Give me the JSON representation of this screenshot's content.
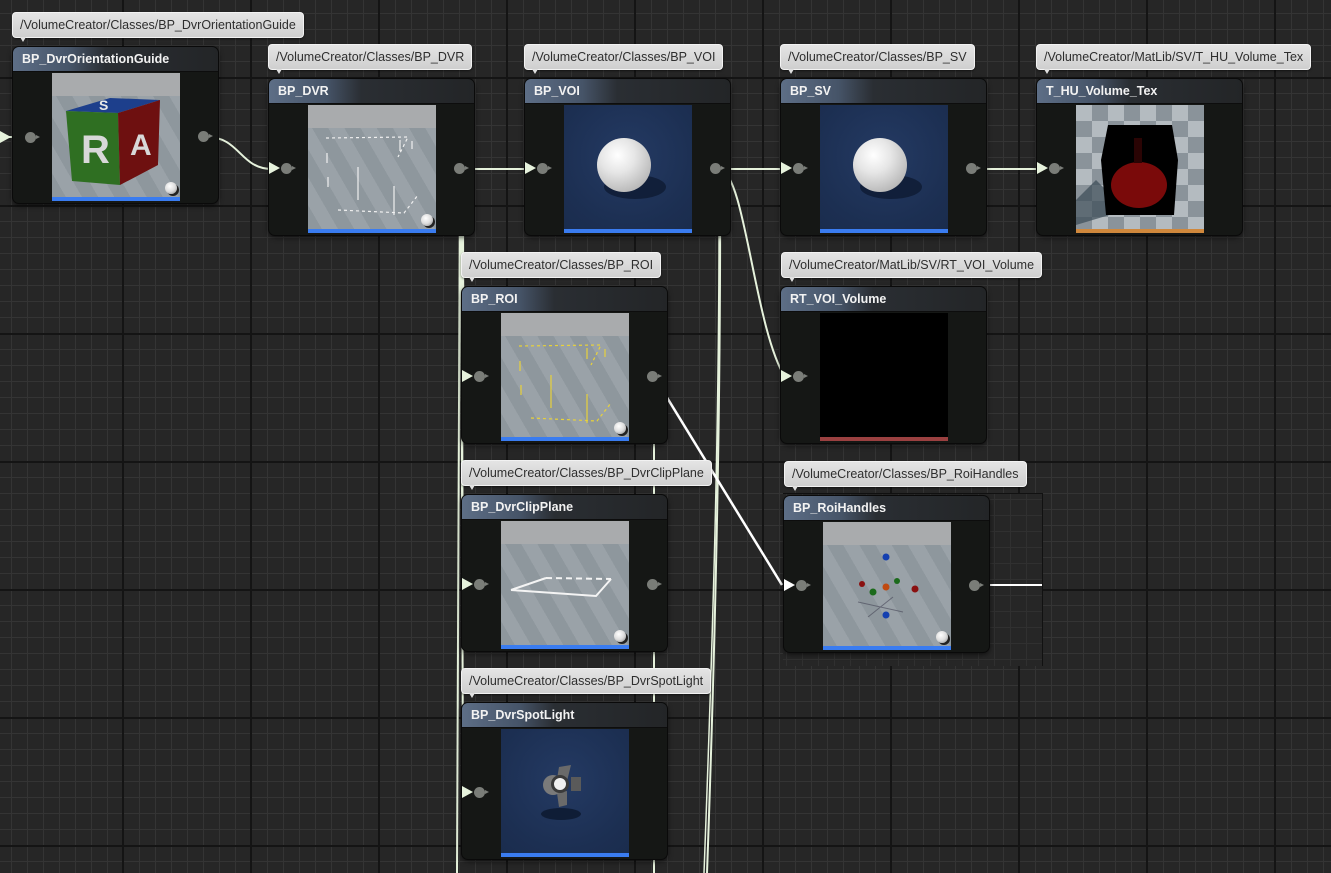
{
  "canvas": {
    "type": "reference-viewer-graph",
    "background": "#262626"
  },
  "colors": {
    "wire": "#e6f2dc",
    "wire_selected": "#ffffff",
    "blueprint_bar": "#3a7cf0",
    "texture_bar": "#d0883c",
    "render_target_bar": "#9a4040"
  },
  "nodes": [
    {
      "id": "orientation",
      "path": "/VolumeCreator/Classes/BP_DvrOrientationGuide",
      "title": "BP_DvrOrientationGuide",
      "thumbnail": "cube-icon",
      "cube_faces": [
        "S",
        "R",
        "A"
      ]
    },
    {
      "id": "dvr",
      "path": "/VolumeCreator/Classes/BP_DVR",
      "title": "BP_DVR",
      "thumbnail": "floor-gizmo-white"
    },
    {
      "id": "voi",
      "path": "/VolumeCreator/Classes/BP_VOI",
      "title": "BP_VOI",
      "thumbnail": "sphere-icon"
    },
    {
      "id": "sv",
      "path": "/VolumeCreator/Classes/BP_SV",
      "title": "BP_SV",
      "thumbnail": "sphere-icon"
    },
    {
      "id": "hu",
      "path": "/VolumeCreator/MatLib/SV/T_HU_Volume_Tex",
      "title": "T_HU_Volume_Tex",
      "thumbnail": "volume-texture"
    },
    {
      "id": "roi",
      "path": "/VolumeCreator/Classes/BP_ROI",
      "title": "BP_ROI",
      "thumbnail": "floor-gizmo-yellow"
    },
    {
      "id": "rtvoi",
      "path": "/VolumeCreator/MatLib/SV/RT_VOI_Volume",
      "title": "RT_VOI_Volume",
      "thumbnail": "black"
    },
    {
      "id": "clip",
      "path": "/VolumeCreator/Classes/BP_DvrClipPlane",
      "title": "BP_DvrClipPlane",
      "thumbnail": "clip-plane"
    },
    {
      "id": "roihandles",
      "path": "/VolumeCreator/Classes/BP_RoiHandles",
      "title": "BP_RoiHandles",
      "thumbnail": "handles"
    },
    {
      "id": "spot",
      "path": "/VolumeCreator/Classes/BP_DvrSpotLight",
      "title": "BP_DvrSpotLight",
      "thumbnail": "spotlight-icon"
    }
  ],
  "links": [
    [
      "orientation",
      "dvr"
    ],
    [
      "dvr",
      "voi"
    ],
    [
      "dvr",
      "roi"
    ],
    [
      "dvr",
      "clip"
    ],
    [
      "dvr",
      "spot"
    ],
    [
      "voi",
      "sv"
    ],
    [
      "voi",
      "rtvoi"
    ],
    [
      "sv",
      "hu"
    ],
    [
      "roi",
      "roihandles"
    ]
  ]
}
